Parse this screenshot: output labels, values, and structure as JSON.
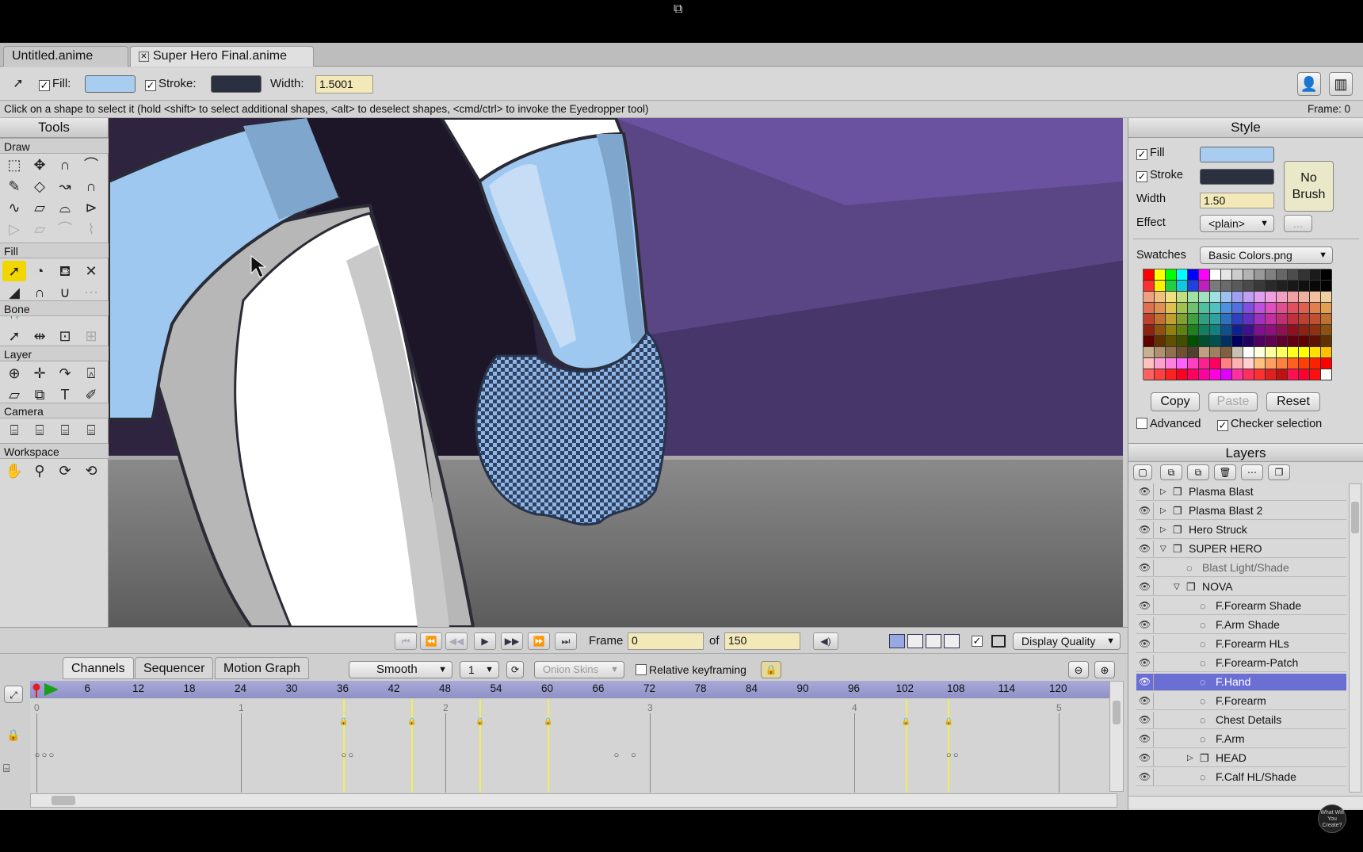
{
  "tabs": [
    {
      "label": "Untitled.anime"
    },
    {
      "label": "Super Hero Final.anime"
    }
  ],
  "toolbar": {
    "fill_label": "Fill:",
    "stroke_label": "Stroke:",
    "width_label": "Width:",
    "width_value": "1.5001",
    "fill_color": "#a8cdf0",
    "stroke_color": "#2a3040"
  },
  "status": {
    "hint": "Click on a shape to select it (hold <shift> to select additional shapes, <alt> to deselect shapes, <cmd/ctrl> to invoke the Eyedropper tool)",
    "frame": "Frame: 0"
  },
  "tools": {
    "title": "Tools",
    "groups": [
      "Draw",
      "Fill",
      "Bone",
      "Layer",
      "Camera",
      "Workspace"
    ]
  },
  "style": {
    "title": "Style",
    "fill_label": "Fill",
    "stroke_label": "Stroke",
    "width_label": "Width",
    "width_value": "1.50",
    "effect_label": "Effect",
    "effect_value": "<plain>",
    "no_brush": "No Brush",
    "swatches_label": "Swatches",
    "swatches_value": "Basic Colors.png",
    "copy": "Copy",
    "paste": "Paste",
    "reset": "Reset",
    "advanced": "Advanced",
    "checker": "Checker selection",
    "more": "..."
  },
  "layers": {
    "title": "Layers",
    "items": [
      {
        "name": "Plasma Blast",
        "indent": 0,
        "expand": "closed"
      },
      {
        "name": "Plasma Blast 2",
        "indent": 0,
        "expand": "closed"
      },
      {
        "name": "Hero Struck",
        "indent": 0,
        "expand": "closed"
      },
      {
        "name": "SUPER HERO",
        "indent": 0,
        "expand": "open"
      },
      {
        "name": "Blast Light/Shade",
        "indent": 1,
        "expand": "none"
      },
      {
        "name": "NOVA",
        "indent": 1,
        "expand": "open"
      },
      {
        "name": "F.Forearm Shade",
        "indent": 2,
        "expand": "none"
      },
      {
        "name": "F.Arm Shade",
        "indent": 2,
        "expand": "none"
      },
      {
        "name": "F.Forearm HLs",
        "indent": 2,
        "expand": "none"
      },
      {
        "name": "F.Forearm-Patch",
        "indent": 2,
        "expand": "none"
      },
      {
        "name": "F.Hand",
        "indent": 2,
        "expand": "none",
        "selected": true
      },
      {
        "name": "F.Forearm",
        "indent": 2,
        "expand": "none"
      },
      {
        "name": "Chest Details",
        "indent": 2,
        "expand": "none"
      },
      {
        "name": "F.Arm",
        "indent": 2,
        "expand": "none"
      },
      {
        "name": "HEAD",
        "indent": 2,
        "expand": "closed"
      },
      {
        "name": "F.Calf HL/Shade",
        "indent": 2,
        "expand": "none"
      }
    ]
  },
  "transport": {
    "frame_label": "Frame",
    "frame_value": "0",
    "of_label": "of",
    "total": "150",
    "display_quality": "Display Quality"
  },
  "timeline": {
    "tabs": [
      "Channels",
      "Sequencer",
      "Motion Graph"
    ],
    "interpolation": "Smooth",
    "interval": "1",
    "onion_skins": "Onion Skins",
    "relative_keyframing": "Relative keyframing",
    "ruler_ticks": [
      "6",
      "12",
      "18",
      "24",
      "30",
      "36",
      "42",
      "48",
      "54",
      "60",
      "66",
      "72",
      "78",
      "84",
      "90",
      "96",
      "102",
      "108",
      "114",
      "120"
    ],
    "seconds": [
      "0",
      "1",
      "2",
      "3",
      "4",
      "5"
    ]
  },
  "watermark": "What Will You Create?"
}
